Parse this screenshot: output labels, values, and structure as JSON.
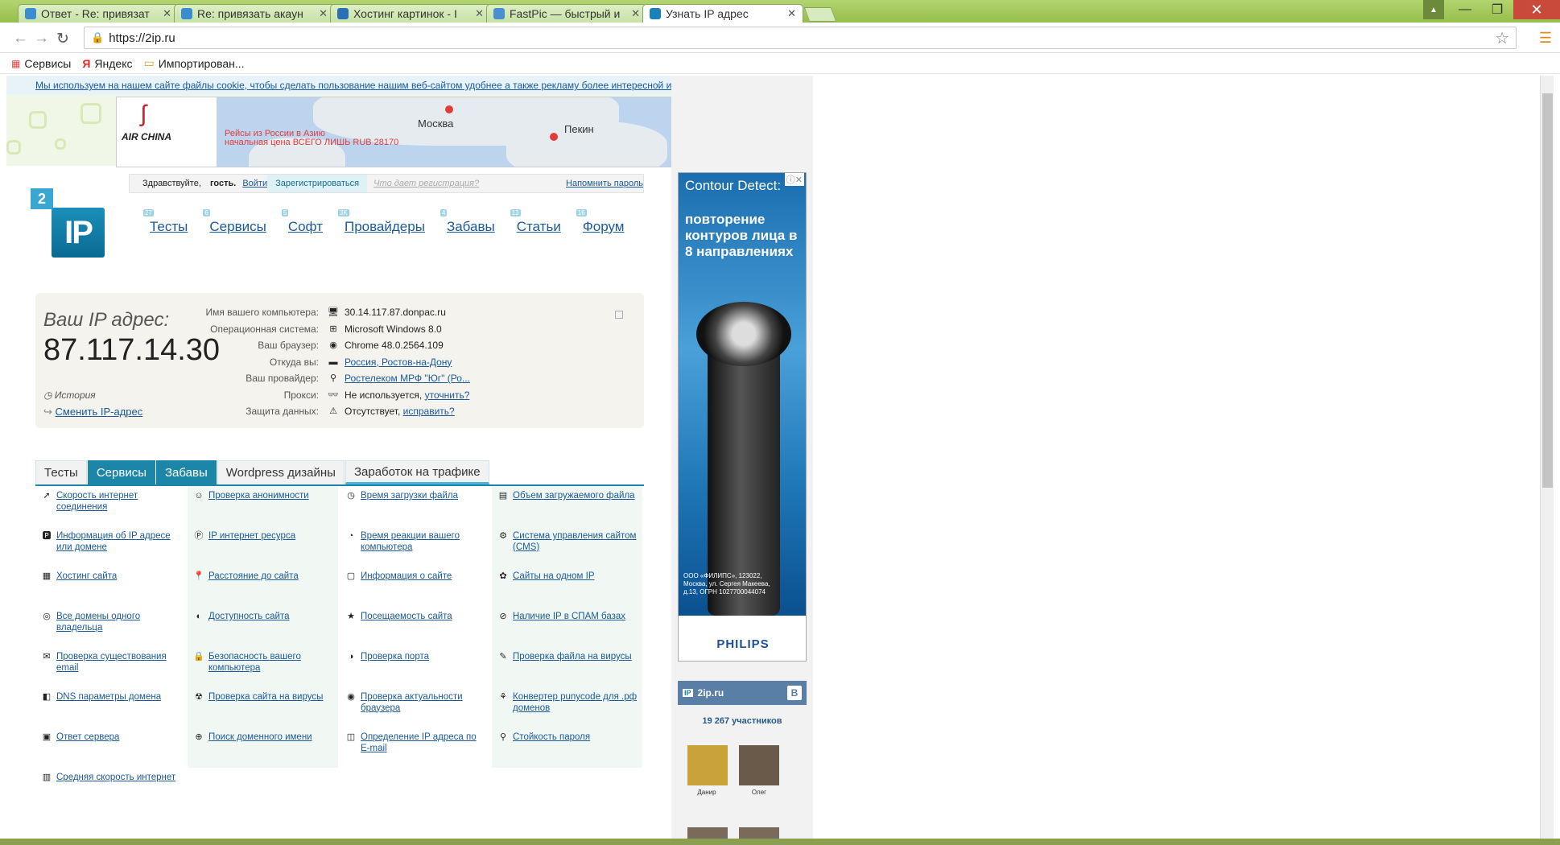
{
  "browser": {
    "tabs": [
      {
        "title": "Ответ - Re: привязат",
        "color": "#3a8dd0"
      },
      {
        "title": "Re: привязать акаун",
        "color": "#3a8dd0"
      },
      {
        "title": "Хостинг картинок - I",
        "color": "#2b6fb5"
      },
      {
        "title": "FastPic — быстрый и",
        "color": "#4a90d0"
      },
      {
        "title": "Узнать IP адрес",
        "color": "#1a82b8"
      }
    ],
    "url": "https://2ip.ru",
    "bookmarks": [
      "Сервисы",
      "Яндекс",
      "Импортирован..."
    ]
  },
  "cookie": {
    "text": "Мы используем на нашем сайте файлы cookie, чтобы сделать пользование нашим веб-сайтом удобнее а также рекламу более интересной и подходящей для вас.",
    "close": "x"
  },
  "banner": {
    "brand": "AIR CHINA",
    "line1": "Рейсы из России в Азию",
    "line2": "начальная цена ВСЕГО ЛИШЬ RUB 28170",
    "city1": "Москва",
    "city2": "Пекин"
  },
  "login": {
    "greeting": "Здравствуйте,",
    "guest": "гость.",
    "login": "Войти",
    "register": "Зарегистрироваться",
    "why": "Что дает регистрация?",
    "remind": "Напомнить пароль"
  },
  "logo": {
    "num": "2",
    "text": "IP"
  },
  "nav": [
    {
      "label": "Тесты",
      "badge": "27"
    },
    {
      "label": "Сервисы",
      "badge": "6"
    },
    {
      "label": "Софт",
      "badge": "5"
    },
    {
      "label": "Провайдеры",
      "badge": "3K"
    },
    {
      "label": "Забавы",
      "badge": "4"
    },
    {
      "label": "Статьи",
      "badge": "13"
    },
    {
      "label": "Форум",
      "badge": "16"
    }
  ],
  "ipinfo": {
    "label": "Ваш IP адрес:",
    "ip": "87.117.14.30",
    "history": "История",
    "change": "Сменить IP-адрес",
    "rows": [
      {
        "k": "Имя вашего компьютера:",
        "v": "30.14.117.87.donpac.ru",
        "link": false
      },
      {
        "k": "Операционная система:",
        "v": "Microsoft Windows 8.0",
        "link": false
      },
      {
        "k": "Ваш браузер:",
        "v": "Chrome 48.0.2564.109",
        "link": false
      },
      {
        "k": "Откуда вы:",
        "v": "Россия, Ростов-на-Дону",
        "link": true
      },
      {
        "k": "Ваш провайдер:",
        "v": "Ростелеком МРФ \"Юг\" (Ро...",
        "link": true
      },
      {
        "k": "Прокси:",
        "v": "Не используется,",
        "extra": "уточнить?",
        "link": false
      },
      {
        "k": "Защита данных:",
        "v": "Отсутствует,",
        "extra": "исправить?",
        "link": false
      }
    ]
  },
  "section_tabs": [
    "Тесты",
    "Сервисы",
    "Забавы",
    "Wordpress дизайны",
    "Заработок на трафике"
  ],
  "services": [
    "Скорость интернет соединения",
    "Проверка анонимности",
    "Время загрузки файла",
    "Объем загружаемого файла",
    "Информация об IP адресе или домене",
    "IP интернет ресурса",
    "Время реакции вашего компьютера",
    "Система управления сайтом (CMS)",
    "Хостинг сайта",
    "Расстояние до сайта",
    "Информация о сайте",
    "Сайты на одном IP",
    "Все домены одного владельца",
    "Доступность сайта",
    "Посещаемость сайта",
    "Наличие IP в СПАМ базах",
    "Проверка существования email",
    "Безопасность вашего компьютера",
    "Проверка порта",
    "Проверка файла на вирусы",
    "DNS параметры домена",
    "Проверка сайта на вирусы",
    "Проверка актуальности браузера",
    "Конвертер punycode для .рф доменов",
    "Ответ сервера",
    "Поиск доменного имени",
    "Определение IP адреса по E-mail",
    "Стойкость пароля",
    "Средняя скорость интернет"
  ],
  "ad": {
    "title": "Contour Detect:",
    "title2": "повторение контуров лица в 8 направлениях",
    "small": "ООО «ФИЛИПС», 123022, Москва, ул. Сергея Макеева, д.13, ОГРН 1027700044074",
    "brand": "PHILIPS"
  },
  "vk": {
    "name": "2ip.ru",
    "letter": "В",
    "count": "19 267 участников",
    "members": [
      "Данир",
      "Олег"
    ]
  }
}
